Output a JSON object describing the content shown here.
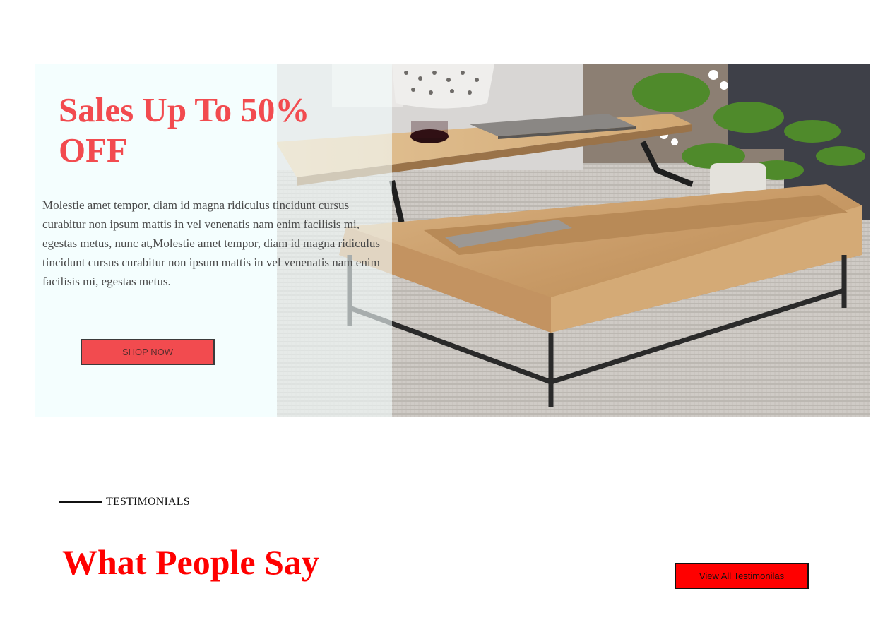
{
  "hero": {
    "title": "Sales Up To 50% OFF",
    "description": "Molestie amet tempor, diam id magna ridiculus tincidunt cursus curabitur non ipsum mattis in vel venenatis nam enim facilisis mi, egestas metus, nunc at,Molestie amet tempor, diam id magna ridiculus tincidunt cursus curabitur non ipsum mattis in vel venenatis nam enim facilisis mi, egestas metus.",
    "cta_label": "SHOP NOW",
    "image_icon": "coffee-table-photo"
  },
  "testimonials": {
    "eyebrow": "TESTIMONIALS",
    "title": "What People Say",
    "view_all_label": "View All Testimonilas"
  },
  "colors": {
    "accent": "#f24b4f",
    "title_red": "#ff0000",
    "panel_tint": "#f4fefe"
  }
}
